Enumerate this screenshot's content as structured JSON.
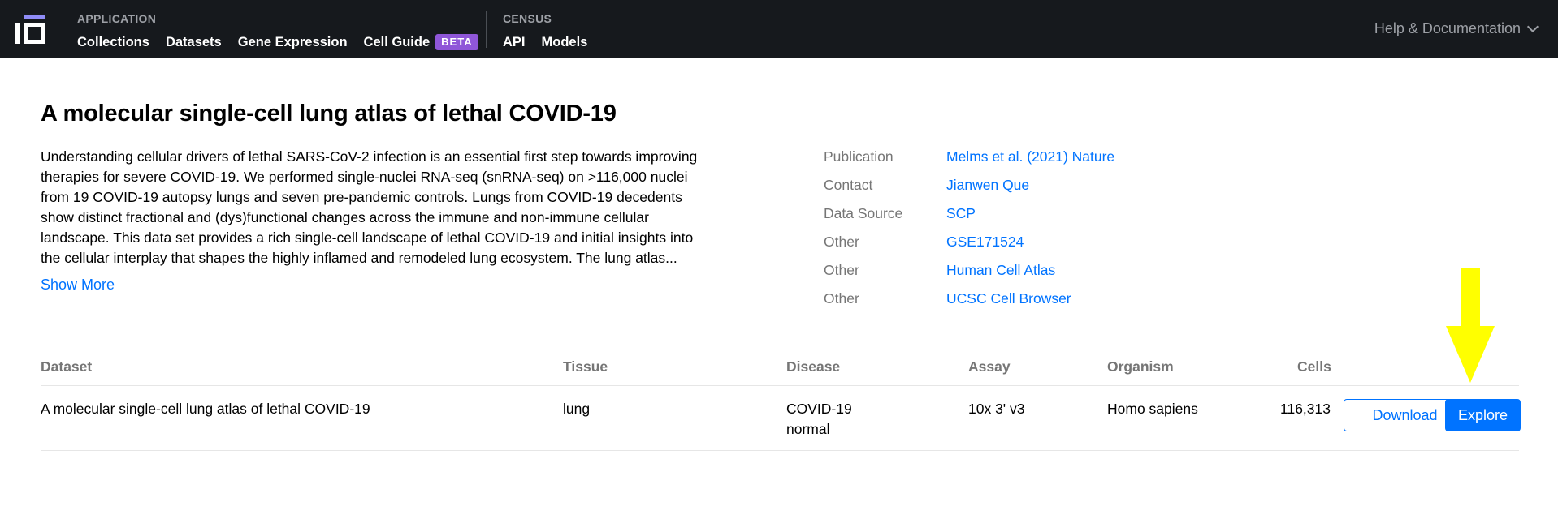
{
  "nav": {
    "application_label": "APPLICATION",
    "links": [
      {
        "label": "Collections"
      },
      {
        "label": "Datasets"
      },
      {
        "label": "Gene Expression"
      },
      {
        "label": "Cell Guide"
      }
    ],
    "beta_badge": "BETA",
    "census_label": "CENSUS",
    "census_links": [
      {
        "label": "API"
      },
      {
        "label": "Models"
      }
    ],
    "help_label": "Help & Documentation",
    "logo_color": "#8f8cf7"
  },
  "collection": {
    "title": "A molecular single-cell lung atlas of lethal COVID-19",
    "description_lines": [
      "Understanding cellular drivers of lethal SARS-CoV-2 infection is an essential first step towards improving",
      "therapies for severe COVID-19. We performed single-nuclei RNA-seq (snRNA-seq) on >116,000 nuclei",
      "from 19 COVID-19 autopsy lungs and seven pre-pandemic controls. Lungs from COVID-19 decedents",
      "show distinct fractional and (dys)functional changes across the immune and non-immune cellular",
      "landscape. This data set provides a rich single-cell landscape of lethal COVID-19 and initial insights into",
      "the cellular interplay that shapes the highly inflamed and remodeled lung ecosystem. The lung atlas..."
    ],
    "show_more": "Show More",
    "metadata": [
      {
        "label": "Publication",
        "value": "Melms et al. (2021) Nature"
      },
      {
        "label": "Contact",
        "value": "Jianwen Que"
      },
      {
        "label": "Data Source",
        "value": "SCP"
      },
      {
        "label": "Other",
        "value": "GSE171524"
      },
      {
        "label": "Other",
        "value": "Human Cell Atlas"
      },
      {
        "label": "Other",
        "value": "UCSC Cell Browser"
      }
    ]
  },
  "table": {
    "headers": {
      "dataset": "Dataset",
      "tissue": "Tissue",
      "disease": "Disease",
      "assay": "Assay",
      "organism": "Organism",
      "cells": "Cells"
    },
    "rows": [
      {
        "dataset": "A molecular single-cell lung atlas of lethal COVID-19",
        "tissue": "lung",
        "disease": [
          "COVID-19",
          "normal"
        ],
        "assay": "10x 3' v3",
        "organism": "Homo sapiens",
        "cells": "116,313",
        "download_label": "Download",
        "explore_label": "Explore"
      }
    ]
  },
  "colors": {
    "nav_bg": "#16191d",
    "link": "#0073ff",
    "beta": "#8f56d8",
    "annotation_arrow": "#ffff00"
  }
}
